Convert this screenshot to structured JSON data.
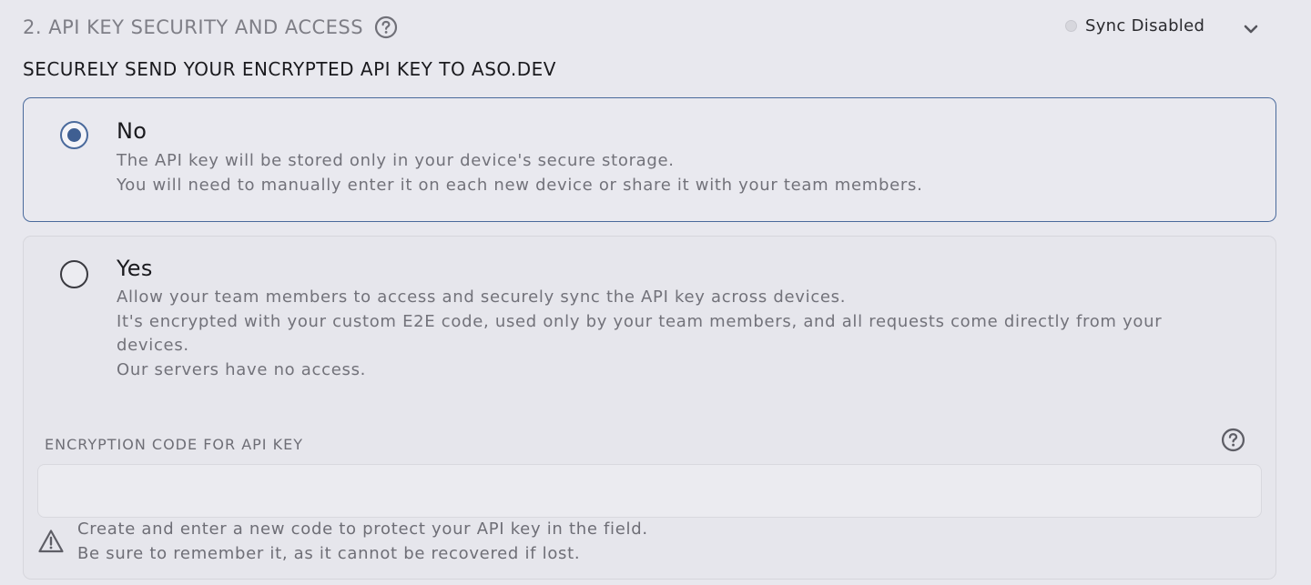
{
  "section": {
    "title": "2. API KEY SECURITY AND ACCESS",
    "help_icon": "question-circle-icon"
  },
  "sync": {
    "status_label": "Sync Disabled",
    "status_color": "#d7d7dd",
    "toggle_icon": "chevron-down-icon"
  },
  "subheading": "SECURELY SEND YOUR ENCRYPTED API KEY TO ASO.DEV",
  "accent_color": "#4a6a9c",
  "options": [
    {
      "title": "No",
      "selected": true,
      "description": [
        "The API key will be stored only in your device's secure storage.",
        "You will need to manually enter it on each new device or share it with your team members."
      ]
    },
    {
      "title": "Yes",
      "selected": false,
      "description": [
        "Allow your team members to access and securely sync the API key across devices.",
        "It's encrypted with your custom E2E code, used only by your team members, and all requests come directly from your devices.",
        "Our servers have no access."
      ]
    }
  ],
  "encryption": {
    "label": "ENCRYPTION CODE FOR API KEY",
    "help_icon": "question-circle-icon",
    "value": "",
    "placeholder": "",
    "warning_icon": "warning-triangle-icon",
    "warning_lines": [
      "Create and enter a new code to protect your API key in the field.",
      "Be sure to remember it, as it cannot be recovered if lost."
    ]
  }
}
